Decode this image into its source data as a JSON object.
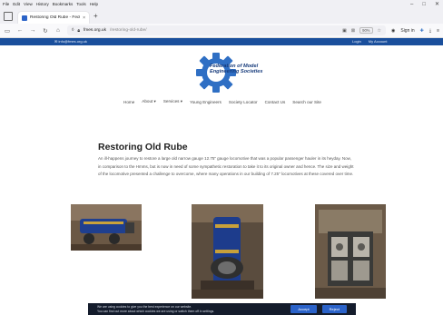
{
  "browser": {
    "menu": [
      "File",
      "Edit",
      "View",
      "History",
      "Bookmarks",
      "Tools",
      "Help"
    ],
    "window_controls": [
      "–",
      "□",
      "✕"
    ],
    "tab_title": "Restoring Old Rube - Federatio",
    "tab_close": "×",
    "new_tab": "+",
    "url_host": "fmes.org.uk",
    "url_rest": "/restoring-old-rube/",
    "zoom": "90%",
    "sign_in": "Sign in"
  },
  "site": {
    "email": "info@fmes.org.uk",
    "login": "Login",
    "my_account": "My Account",
    "logo_lines": [
      "Federation of Model",
      "Engineering Societies"
    ],
    "nav": [
      "Home",
      "About ▾",
      "Services ▾",
      "Young Engineers",
      "Society Locator",
      "Contact Us",
      "Search our Site"
    ]
  },
  "article": {
    "title": "Restoring Old Rube",
    "intro": "An ill-happens journey to restore a large old narrow gauge 12.75\" gauge locomotive that was a popular passenger hauler in its heyday. Now, in comparison to the Hmms, but is now in need of some sympathetic restoration to take it to its original owner and hence. The size and weight of the locomotive presented a challenge to overcome, where many operations in our building of 7.25\" locomotives at these covered over time."
  },
  "cookie": {
    "text_line1": "We are using cookies to give you the best experience on our website.",
    "text_line2": "You can find out more about which cookies we are using or switch them off in settings.",
    "accept": "Accept",
    "reject": "Reject"
  },
  "colors": {
    "brand_blue": "#1a4f9c",
    "logo_navy": "#14397a",
    "gear_blue": "#2f6fc4",
    "cookie_bg": "#141c2c",
    "button_blue": "#2a62c9"
  }
}
